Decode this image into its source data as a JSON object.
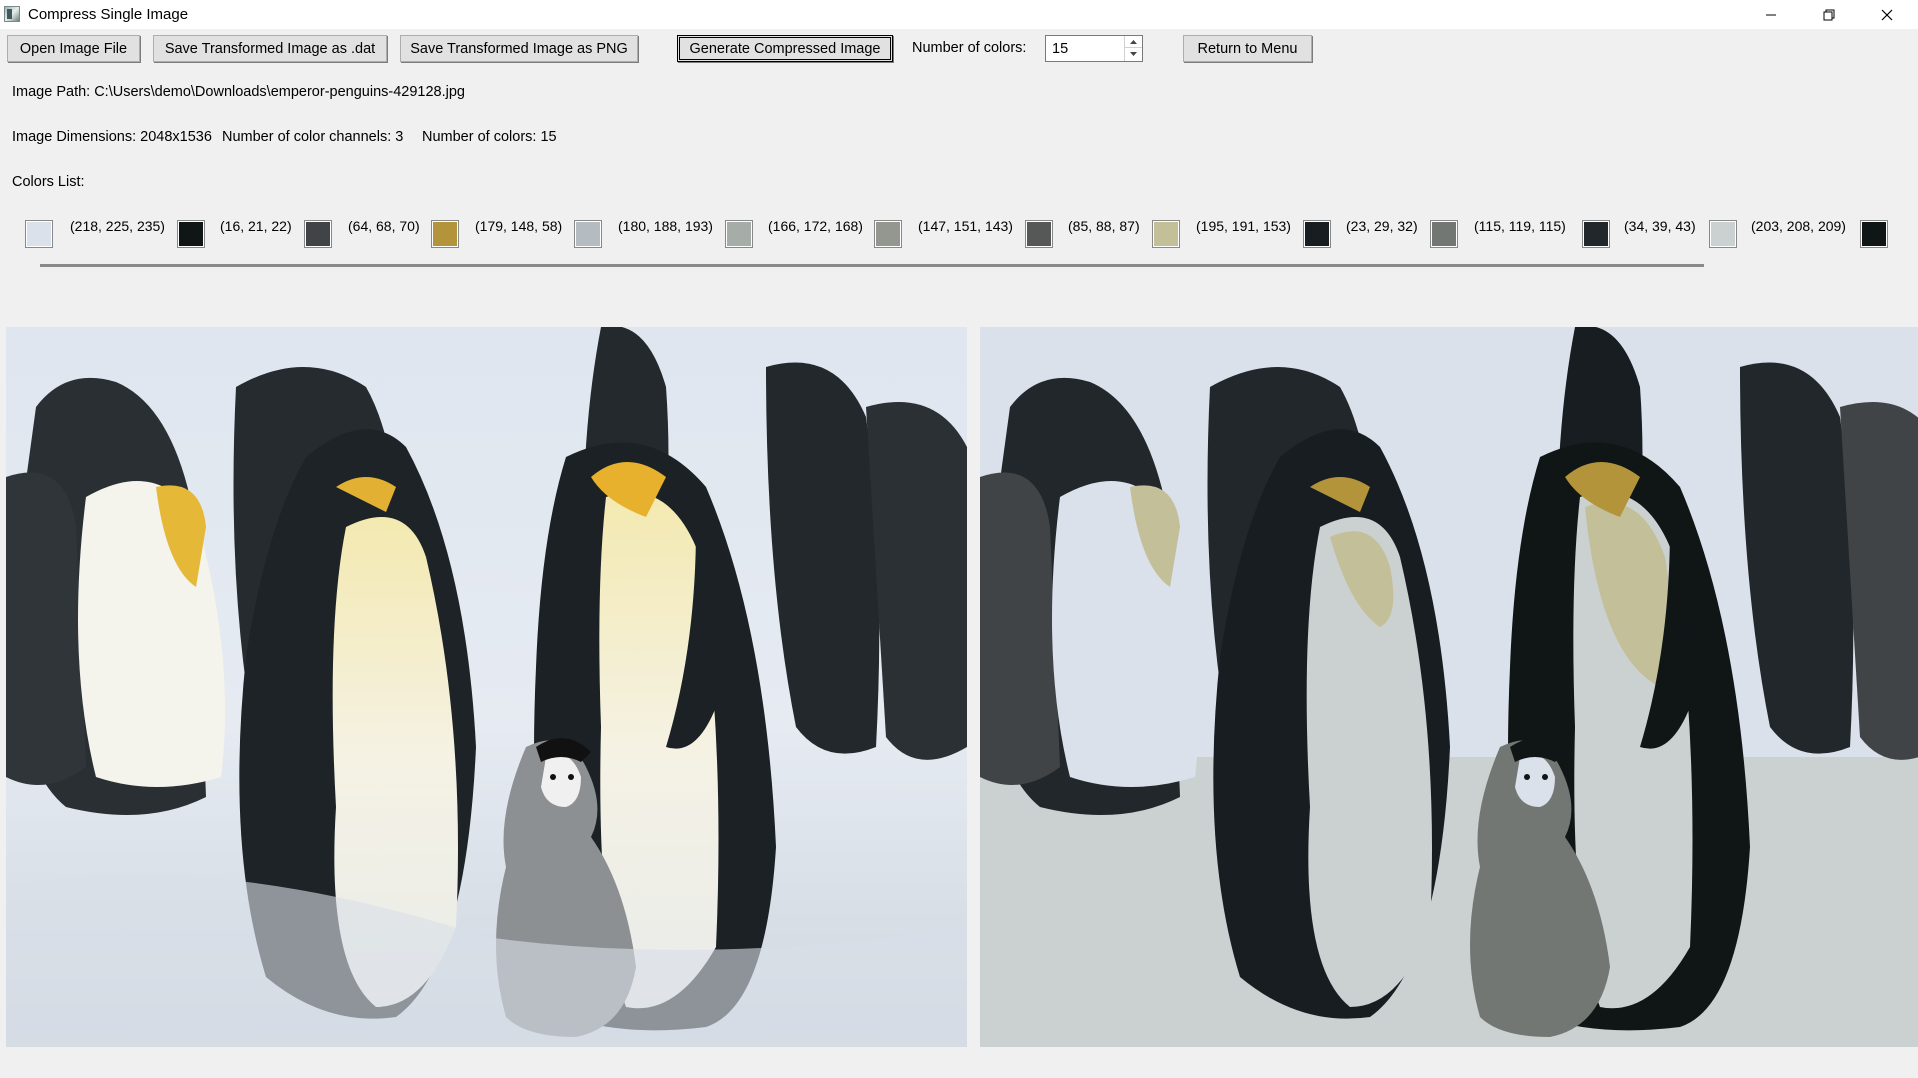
{
  "window": {
    "title": "Compress Single Image",
    "icon": "app-icon",
    "controls": [
      "minimize-icon",
      "restore-icon",
      "close-icon"
    ]
  },
  "toolbar": {
    "open_label": "Open Image File",
    "save_dat_label": "Save Transformed Image as .dat",
    "save_png_label": "Save Transformed Image as PNG",
    "generate_label": "Generate Compressed Image",
    "num_colors_label": "Number of colors:",
    "num_colors_value": "15",
    "return_label": "Return to Menu"
  },
  "info": {
    "image_path": "Image Path: C:\\Users\\demo\\Downloads\\emperor-penguins-429128.jpg",
    "dimensions": "Image Dimensions: 2048x1536",
    "channels": "Number of color channels: 3",
    "colors": "Number of colors: 15",
    "colors_list_label": "Colors List:"
  },
  "palette": [
    {
      "label": "(218, 225, 235)",
      "color": "#dae1eb"
    },
    {
      "label": "(16, 21, 22)",
      "color": "#101516"
    },
    {
      "label": "(64, 68, 70)",
      "color": "#404446"
    },
    {
      "label": "(179, 148, 58)",
      "color": "#b3943a"
    },
    {
      "label": "(180, 188, 193)",
      "color": "#b4bcc1"
    },
    {
      "label": "(166, 172, 168)",
      "color": "#a6aca8"
    },
    {
      "label": "(147, 151, 143)",
      "color": "#93978f"
    },
    {
      "label": "(85, 88, 87)",
      "color": "#555857"
    },
    {
      "label": "(195, 191, 153)",
      "color": "#c3bf99"
    },
    {
      "label": "(23, 29, 32)",
      "color": "#171d20"
    },
    {
      "label": "(115, 119, 115)",
      "color": "#737773"
    },
    {
      "label": "(34, 39, 43)",
      "color": "#22272b"
    },
    {
      "label": "(203, 208, 209)",
      "color": "#cbd0d1"
    }
  ],
  "trailing_swatch_color": "#101516",
  "images": {
    "original": "original-image",
    "compressed": "compressed-image"
  }
}
